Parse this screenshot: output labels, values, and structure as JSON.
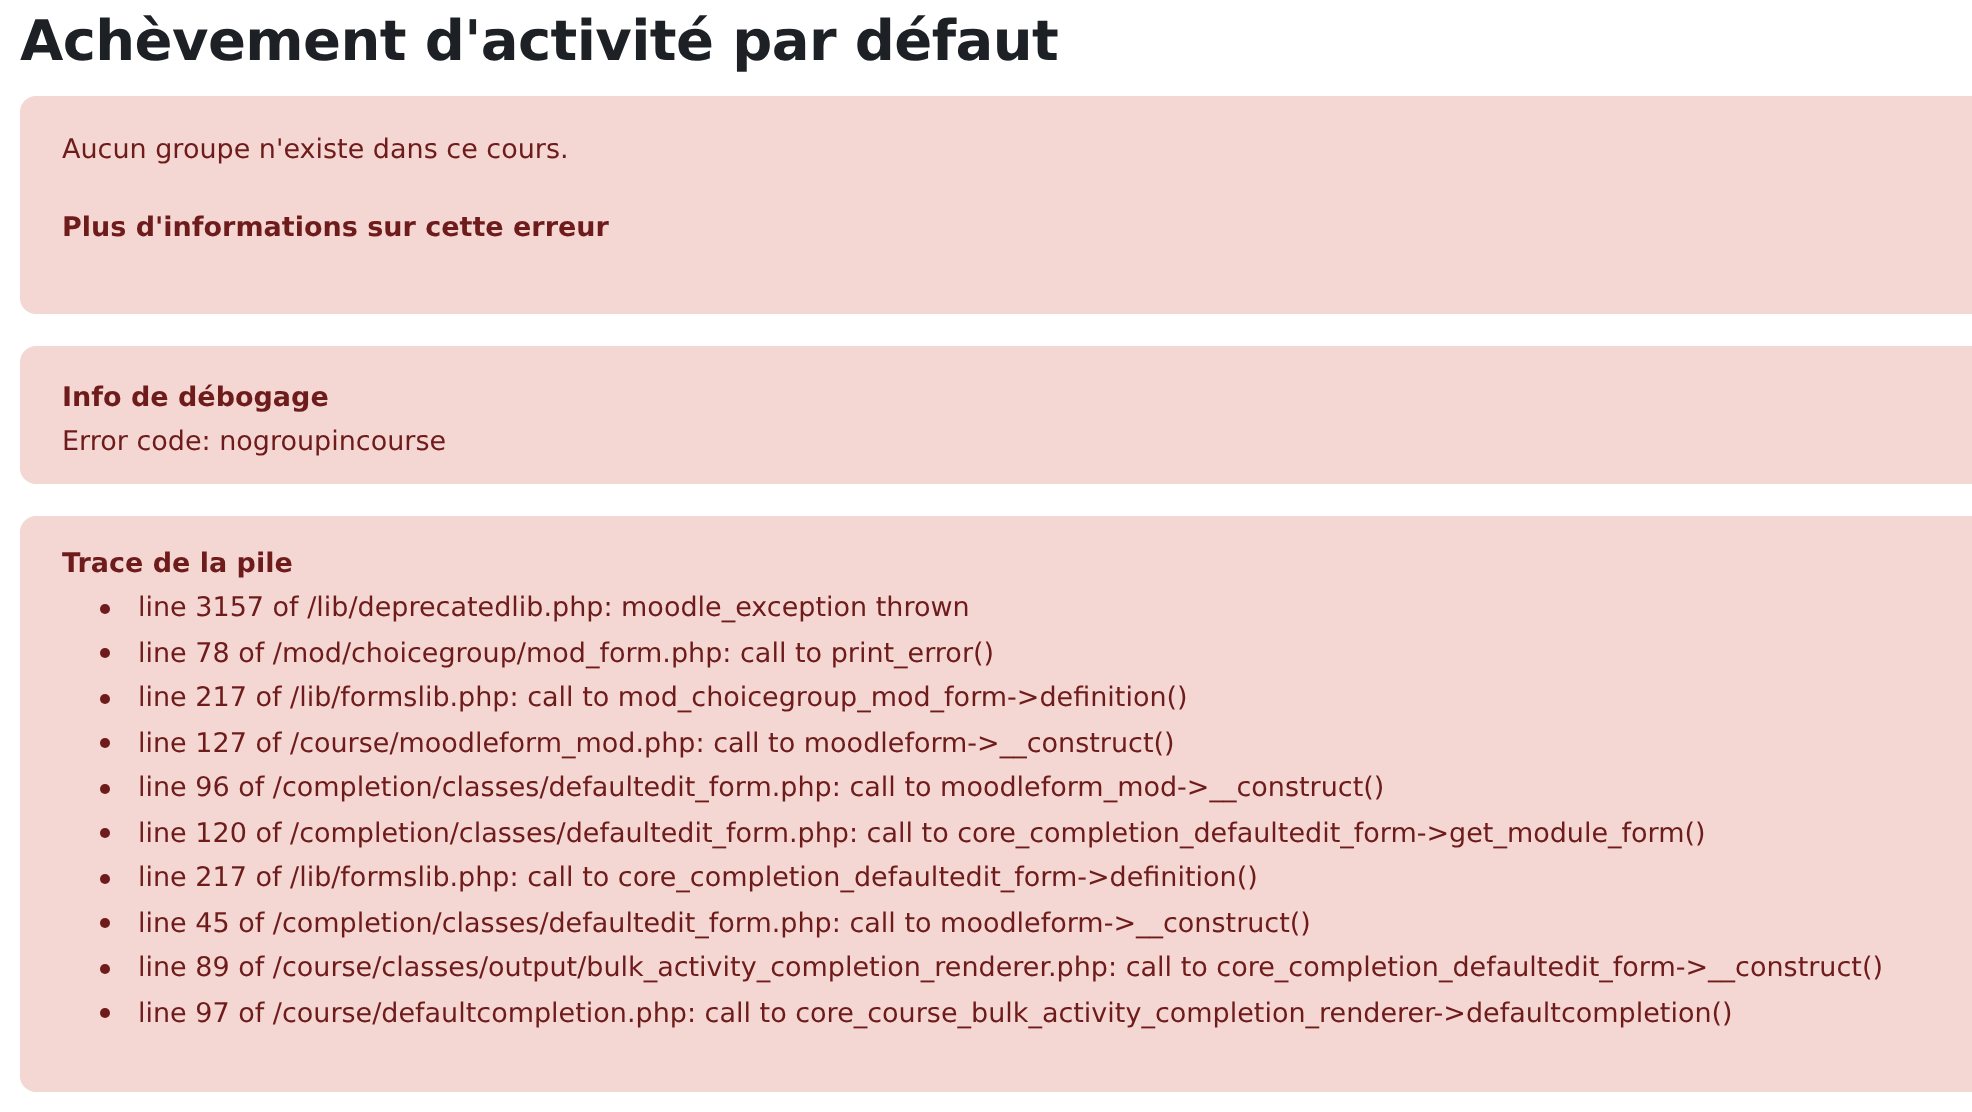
{
  "page": {
    "title": "Achèvement d'activité par défaut"
  },
  "error": {
    "message": "Aucun groupe n'existe dans ce cours.",
    "more_info": "Plus d'informations sur cette erreur"
  },
  "debug": {
    "heading": "Info de débogage",
    "error_code": "Error code: nogroupincourse"
  },
  "stack_trace": {
    "heading": "Trace de la pile",
    "lines": [
      "line 3157 of /lib/deprecatedlib.php: moodle_exception thrown",
      "line 78 of /mod/choicegroup/mod_form.php: call to print_error()",
      "line 217 of /lib/formslib.php: call to mod_choicegroup_mod_form->definition()",
      "line 127 of /course/moodleform_mod.php: call to moodleform->__construct()",
      "line 96 of /completion/classes/defaultedit_form.php: call to moodleform_mod->__construct()",
      "line 120 of /completion/classes/defaultedit_form.php: call to core_completion_defaultedit_form->get_module_form()",
      "line 217 of /lib/formslib.php: call to core_completion_defaultedit_form->definition()",
      "line 45 of /completion/classes/defaultedit_form.php: call to moodleform->__construct()",
      "line 89 of /course/classes/output/bulk_activity_completion_renderer.php: call to core_completion_defaultedit_form->__construct()",
      "line 97 of /course/defaultcompletion.php: call to core_course_bulk_activity_completion_renderer->defaultcompletion()"
    ]
  }
}
